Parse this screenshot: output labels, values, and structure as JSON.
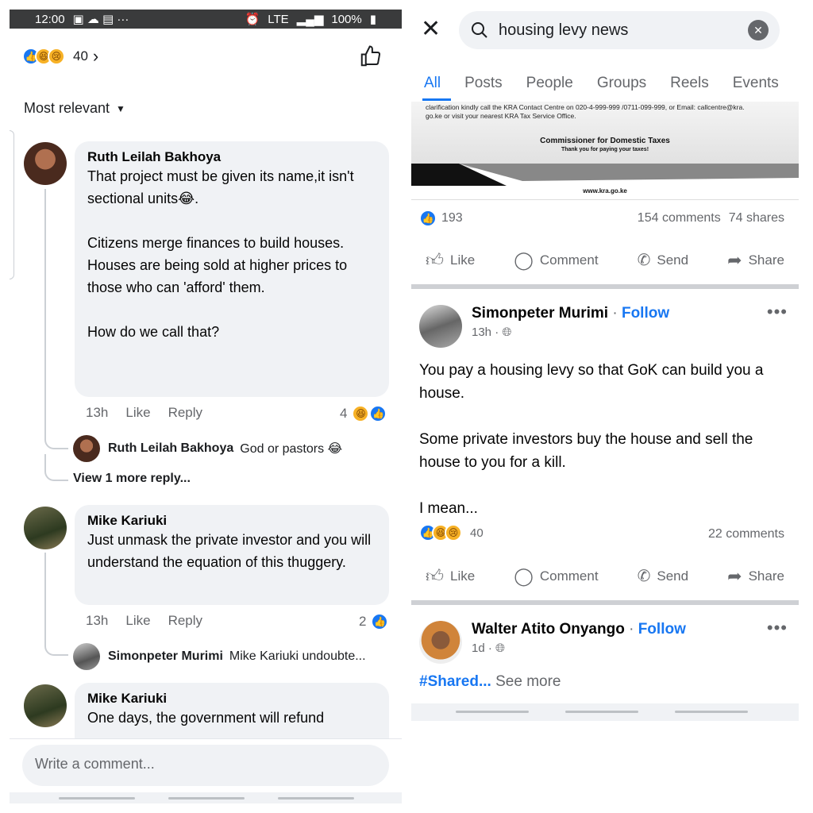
{
  "left": {
    "status": {
      "time": "12:00",
      "battery": "100%",
      "network": "LTE"
    },
    "reactions_count": "40",
    "sort_label": "Most relevant",
    "comments": [
      {
        "name": "Ruth Leilah Bakhoya",
        "text": "That project must be given its name,it isn't sectional units😂.\n\nCitizens merge finances to build houses.\n Houses are being sold at higher prices to those who can 'afford' them.\n\nHow do we call that?",
        "time": "13h",
        "like": "Like",
        "reply": "Reply",
        "react_count": "4"
      },
      {
        "name": "Mike Kariuki",
        "text": "Just unmask the private investor and you will understand the equation of this thuggery.",
        "time": "13h",
        "like": "Like",
        "reply": "Reply",
        "react_count": "2"
      },
      {
        "name": "Mike Kariuki",
        "text": "One days, the government will refund"
      }
    ],
    "replies": [
      {
        "name": "Ruth Leilah Bakhoya",
        "text": "God or pastors 😂"
      },
      {
        "name": "Simonpeter Murimi",
        "text": "Mike Kariuki undoubte..."
      }
    ],
    "view_more": "View 1 more reply...",
    "write_placeholder": "Write a comment..."
  },
  "right": {
    "search_query": "housing levy news",
    "tabs": [
      "All",
      "Posts",
      "People",
      "Groups",
      "Reels",
      "Events"
    ],
    "kra": {
      "line1": "clarification kindly call the KRA Contact Centre on 020-4-999-999 /0711-099-999, or Email: callcentre@kra.",
      "line2": "go.ke or visit your nearest KRA Tax Service Office.",
      "title": "Commissioner for Domestic Taxes",
      "thanks": "Thank you for paying your taxes!",
      "url": "www.kra.go.ke"
    },
    "post1_stats": {
      "likes": "193",
      "comments": "154 comments",
      "shares": "74 shares"
    },
    "actions": {
      "like": "Like",
      "comment": "Comment",
      "send": "Send",
      "share": "Share"
    },
    "post2": {
      "name": "Simonpeter Murimi",
      "follow": "Follow",
      "time": "13h",
      "text": "You pay a housing levy so that GoK can build you a house.\n\nSome private investors buy the house and sell the house to you for a kill.\n\nI mean...",
      "react_count": "40",
      "comments": "22 comments"
    },
    "post3": {
      "name": "Walter Atito Onyango",
      "follow": "Follow",
      "time": "1d",
      "hashtag": "#Shared...",
      "see_more": "See more"
    }
  }
}
